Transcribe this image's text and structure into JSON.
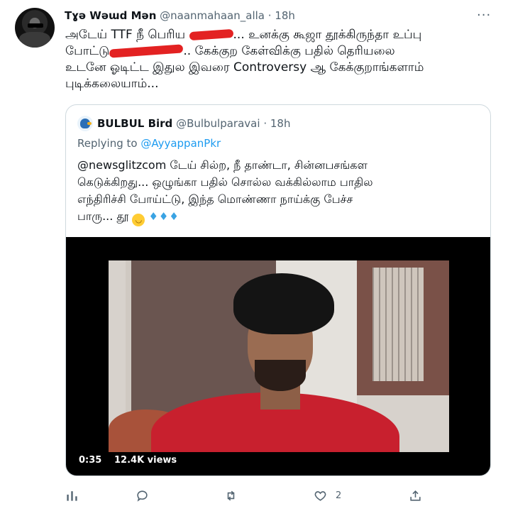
{
  "tweet": {
    "author_name": "Tɣǝ Wǝɯd Mǝn",
    "handle": "@naanmahaan_alla",
    "separator": "·",
    "time": "18h",
    "more_glyph": "···",
    "lines": [
      {
        "before": "அடேய் TTF நீ பெரிய ",
        "after": "... உனக்கு கூஜா தூக்கிருந்தா உப்பு"
      },
      {
        "before": "போட்டு",
        "after": ".. கேக்குற கேள்விக்கு பதில் தெரியலை"
      },
      {
        "text": "உடனே ஓடிட்ட இதுல இவரை Controversy ஆ கேக்குறாங்களாம்"
      },
      {
        "text": "புடிக்கலையாம்..."
      }
    ]
  },
  "quoted": {
    "author_name": "BULBUL Bird",
    "handle": "@Bulbulparavai",
    "separator": "·",
    "time": "18h",
    "replying_prefix": "Replying to ",
    "replying_mention": "@AyyappanPkr",
    "lines": [
      "@newsglitzcom டேய் சில்ற, நீ தாண்டா, சின்னபசங்கள",
      "கெடுக்கிறது... ஒழுங்கா பதில் சொல்ல வக்கில்லாம பாதில",
      "எந்திரிச்சி போய்ட்டு, இந்த மொண்ணா நாய்க்கு பேச்ச",
      "பாரு... தூ"
    ],
    "emoji_face": "😙",
    "emoji_drops": "💦💦💦",
    "video": {
      "duration": "0:35",
      "views": "12.4K views"
    }
  },
  "actions": {
    "analytics_icon": "analytics-icon",
    "reply_icon": "reply-icon",
    "retweet_icon": "retweet-icon",
    "like_icon": "like-icon",
    "like_count": "2",
    "share_icon": "share-icon"
  },
  "colors": {
    "text": "#0f1419",
    "secondary": "#536471",
    "link": "#1d9bf0",
    "border": "#cfd9de",
    "redaction": "#e32222"
  }
}
